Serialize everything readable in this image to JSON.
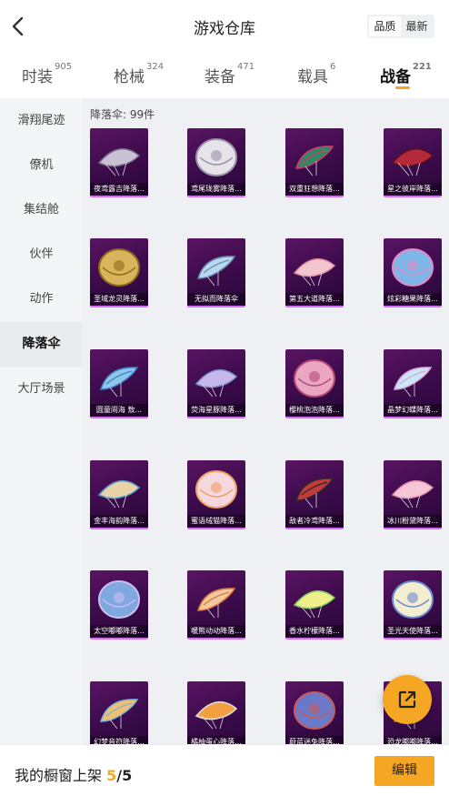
{
  "header": {
    "title": "游戏仓库",
    "sort_options": [
      "品质",
      "最新"
    ]
  },
  "tabs": [
    {
      "label": "时装",
      "count": "905"
    },
    {
      "label": "枪械",
      "count": "324"
    },
    {
      "label": "装备",
      "count": "471"
    },
    {
      "label": "载具",
      "count": "6"
    },
    {
      "label": "战备",
      "count": "221"
    }
  ],
  "sidebar": {
    "items": [
      "滑翔尾迹",
      "僚机",
      "集结舱",
      "伙伴",
      "动作",
      "降落伞",
      "大厅场景"
    ]
  },
  "content": {
    "count_label": "降落伞: 99件",
    "items": [
      {
        "name": "夜鸢露吉降落...",
        "icon": "parachute-dark-feather-icon"
      },
      {
        "name": "鸢尾珑雾降落...",
        "icon": "parachute-white-wing-icon"
      },
      {
        "name": "双重狂想降落...",
        "icon": "parachute-jester-icon"
      },
      {
        "name": "星之彼岸降落...",
        "icon": "parachute-red-floral-icon"
      },
      {
        "name": "圣域龙灵降落...",
        "icon": "parachute-gold-dragon-icon"
      },
      {
        "name": "无拟而降落伞",
        "icon": "parachute-jellyfish-icon"
      },
      {
        "name": "第五大道降落...",
        "icon": "parachute-pink-round-icon"
      },
      {
        "name": "炫彩糖果降落...",
        "icon": "parachute-candy-icon"
      },
      {
        "name": "圆童闹海 敖...",
        "icon": "parachute-blue-wave-icon"
      },
      {
        "name": "荧海星豚降落...",
        "icon": "parachute-dolphin-icon"
      },
      {
        "name": "樱桃泡泡降落...",
        "icon": "parachute-cherry-icon"
      },
      {
        "name": "晶梦幻蝶降落...",
        "icon": "parachute-butterfly-icon"
      },
      {
        "name": "金丰海韵降落...",
        "icon": "parachute-shell-icon"
      },
      {
        "name": "蜜语绒猫降落...",
        "icon": "parachute-cat-icon"
      },
      {
        "name": "敌者冷鸢降落...",
        "icon": "parachute-red-black-icon"
      },
      {
        "name": "冰川粉黛降落...",
        "icon": "parachute-pink-dome-icon"
      },
      {
        "name": "太空嘟嘟降落...",
        "icon": "parachute-space-icon"
      },
      {
        "name": "暖熊动动降落...",
        "icon": "parachute-red-panda-icon"
      },
      {
        "name": "香水柠檬降落...",
        "icon": "parachute-lemon-icon"
      },
      {
        "name": "圣光天使降落...",
        "icon": "parachute-angel-icon"
      },
      {
        "name": "幻梦音符降落...",
        "icon": "parachute-music-icon"
      },
      {
        "name": "橘柚蛋心降落...",
        "icon": "parachute-orange-icon"
      },
      {
        "name": "蔚蓝迷兔降落...",
        "icon": "parachute-rabbit-icon"
      },
      {
        "name": "恐龙嘟嘟降落...",
        "icon": "parachute-dino-icon"
      }
    ]
  },
  "bottom": {
    "showcase_label": "我的橱窗上架 ",
    "showcase_count": "5",
    "showcase_sep": "/",
    "showcase_total": "5",
    "edit_label": "编辑"
  },
  "colors": {
    "accent": "#f5a623",
    "card_bg": "#4a0f58",
    "card_border": "#d86cff"
  }
}
